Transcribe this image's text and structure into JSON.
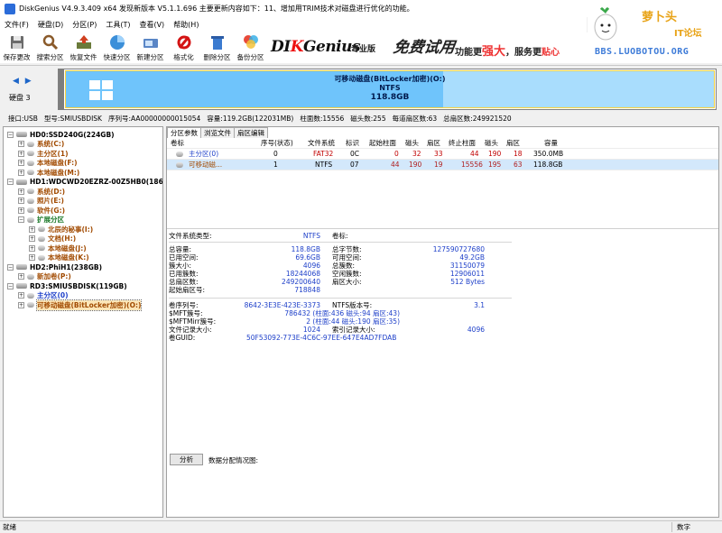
{
  "window": {
    "title": "DiskGenius V4.9.3.409 x64    发现新版本 V5.1.1.696 主要更新内容如下：11、增加用TRIM技术对磁盘进行优化的功能。"
  },
  "menu": [
    "文件(F)",
    "硬盘(D)",
    "分区(P)",
    "工具(T)",
    "查看(V)",
    "帮助(H)"
  ],
  "toolbar": [
    {
      "label": "保存更改",
      "icon": "save-icon"
    },
    {
      "label": "搜索分区",
      "icon": "search-icon"
    },
    {
      "label": "恢复文件",
      "icon": "recover-icon"
    },
    {
      "label": "快速分区",
      "icon": "quick-partition-icon"
    },
    {
      "label": "新建分区",
      "icon": "new-partition-icon"
    },
    {
      "label": "格式化",
      "icon": "format-icon"
    },
    {
      "label": "删除分区",
      "icon": "delete-icon"
    },
    {
      "label": "备份分区",
      "icon": "backup-icon"
    }
  ],
  "banner": {
    "brand_a": "DI",
    "brand_b": "K",
    "brand_c": "Genius",
    "edition": "专业版",
    "promo": "免费试用",
    "slogan_a": "功能更",
    "slogan_b": "强大",
    "slogan_c": "，服务更",
    "slogan_d": "贴心"
  },
  "logo": {
    "name": "萝卜头",
    "tag": "IT论坛",
    "url": "BBS.LUOBOTOU.ORG"
  },
  "diskbar": {
    "nav": "◀ ▶",
    "disk_label": "硬盘 3",
    "partition_name": "可移动磁盘(BitLocker加密)(O:)",
    "fs": "NTFS",
    "size": "118.8GB"
  },
  "diskinfo": [
    "接口:USB",
    "型号:SMIUSBDISK",
    "序列号:AA00000000015054",
    "容量:119.2GB(122031MB)",
    "柱面数:15556",
    "磁头数:255",
    "每道扇区数:63",
    "总扇区数:249921520"
  ],
  "tree": [
    {
      "depth": 0,
      "exp": "−",
      "label": "HD0:SSD240G(224GB)",
      "kind": "disk",
      "color": "black"
    },
    {
      "depth": 1,
      "exp": "+",
      "label": "系统(C:)",
      "kind": "part",
      "color": "brown"
    },
    {
      "depth": 1,
      "exp": "+",
      "label": "主分区(1)",
      "kind": "part",
      "color": "brown"
    },
    {
      "depth": 1,
      "exp": "+",
      "label": "本地磁盘(F:)",
      "kind": "part",
      "color": "brown"
    },
    {
      "depth": 1,
      "exp": "+",
      "label": "本地磁盘(M:)",
      "kind": "part",
      "color": "brown"
    },
    {
      "depth": 0,
      "exp": "−",
      "label": "HD1:WDCWD20EZRZ-00Z5HB0(1863GB)",
      "kind": "disk",
      "color": "black"
    },
    {
      "depth": 1,
      "exp": "+",
      "label": "系统(D:)",
      "kind": "part",
      "color": "brown"
    },
    {
      "depth": 1,
      "exp": "+",
      "label": "照片(E:)",
      "kind": "part",
      "color": "brown"
    },
    {
      "depth": 1,
      "exp": "+",
      "label": "软件(G:)",
      "kind": "part",
      "color": "brown"
    },
    {
      "depth": 1,
      "exp": "−",
      "label": "扩展分区",
      "kind": "ext",
      "color": "green"
    },
    {
      "depth": 2,
      "exp": "+",
      "label": "北辰的秘事(I:)",
      "kind": "part",
      "color": "brown"
    },
    {
      "depth": 2,
      "exp": "+",
      "label": "文档(H:)",
      "kind": "part",
      "color": "brown"
    },
    {
      "depth": 2,
      "exp": "+",
      "label": "本地磁盘(J:)",
      "kind": "part",
      "color": "brown"
    },
    {
      "depth": 2,
      "exp": "+",
      "label": "本地磁盘(K:)",
      "kind": "part",
      "color": "brown"
    },
    {
      "depth": 0,
      "exp": "−",
      "label": "HD2:PhiH1(238GB)",
      "kind": "disk",
      "color": "black"
    },
    {
      "depth": 1,
      "exp": "+",
      "label": "新加卷(P:)",
      "kind": "part",
      "color": "brown"
    },
    {
      "depth": 0,
      "exp": "−",
      "label": "RD3:SMIUSBDISK(119GB)",
      "kind": "disk",
      "color": "black"
    },
    {
      "depth": 1,
      "exp": "+",
      "label": "主分区(0)",
      "kind": "part",
      "color": "blue"
    },
    {
      "depth": 1,
      "exp": "+",
      "label": "可移动磁盘(BitLocker加密)(O:)",
      "kind": "part",
      "color": "brown",
      "selected": true
    }
  ],
  "tabs": [
    "分区参数",
    "浏览文件",
    "扇区编辑"
  ],
  "partition_table": {
    "headers": [
      "卷标",
      "序号(状态)",
      "文件系统",
      "标识",
      "起始柱面",
      "磁头",
      "扇区",
      "终止柱面",
      "磁头",
      "扇区",
      "容量"
    ],
    "rows": [
      [
        "主分区(0)",
        "0",
        "FAT32",
        "0C",
        "0",
        "32",
        "33",
        "44",
        "190",
        "18",
        "350.0MB"
      ],
      [
        "可移动磁...",
        "1",
        "NTFS",
        "07",
        "44",
        "190",
        "19",
        "15556",
        "195",
        "63",
        "118.8GB"
      ]
    ]
  },
  "details": {
    "fs_type_label": "文件系统类型:",
    "fs_type": "NTFS",
    "vol_label": "卷标:",
    "total_cap_label": "总容量:",
    "total_cap": "118.8GB",
    "total_bytes_label": "总字节数:",
    "total_bytes": "127590727680",
    "used_label": "已用空间:",
    "used": "69.6GB",
    "free_label": "可用空间:",
    "free": "49.2GB",
    "cluster_label": "簇大小:",
    "cluster": "4096",
    "total_clusters_label": "总簇数:",
    "total_clusters": "31150079",
    "used_clusters_label": "已用簇数:",
    "used_clusters": "18244068",
    "free_clusters_label": "空闲簇数:",
    "free_clusters": "12906011",
    "total_sectors_label": "总扇区数:",
    "total_sectors": "249200640",
    "sector_size_label": "扇区大小:",
    "sector_size": "512 Bytes",
    "start_sector_label": "起始扇区号:",
    "start_sector": "718848",
    "serial_label": "卷序列号:",
    "serial": "8642-3E3E-423E-3373",
    "ntfs_ver_label": "NTFS版本号:",
    "ntfs_ver": "3.1",
    "mft_label": "$MFT簇号:",
    "mft": "786432 (柱面:436 磁头:94 扇区:43)",
    "mftmirr_label": "$MFTMirr簇号:",
    "mftmirr": "2 (柱面:44 磁头:190 扇区:35)",
    "rec_size_label": "文件记录大小:",
    "rec_size": "1024",
    "idx_size_label": "索引记录大小:",
    "idx_size": "4096",
    "guid_label": "卷GUID:",
    "guid": "50F53092-773E-4C6C-97EE-647E4AD7FDAB"
  },
  "analyze": {
    "button": "分析",
    "label": "数据分配情况图:"
  },
  "status": {
    "ready": "就绪",
    "num": "数字"
  }
}
